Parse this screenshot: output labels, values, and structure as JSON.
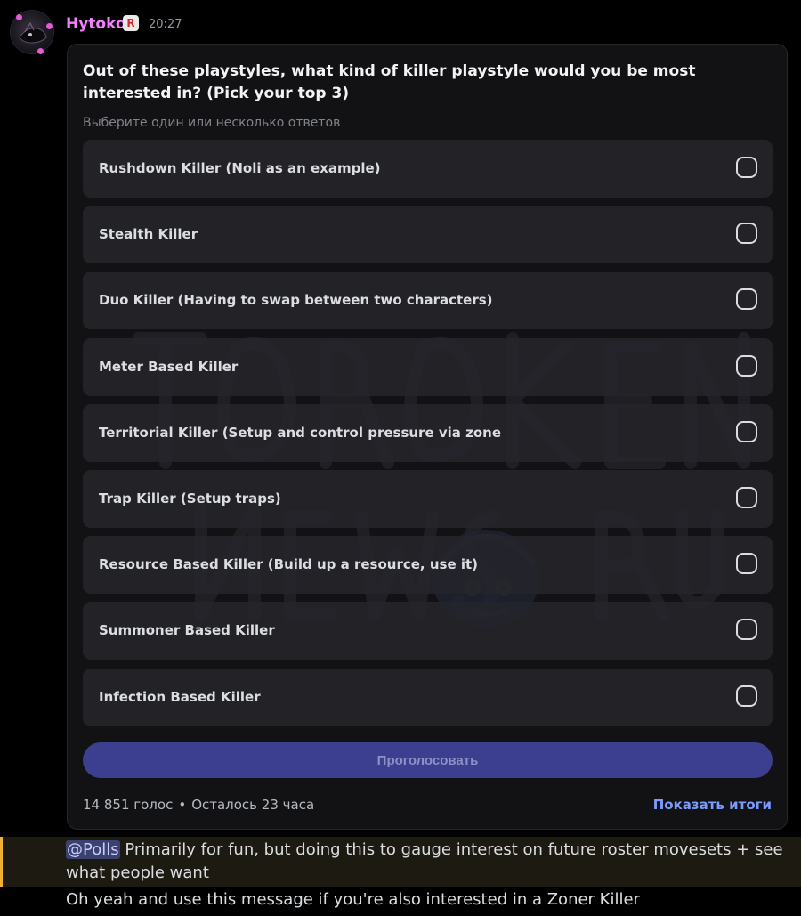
{
  "header": {
    "username": "Hytoko",
    "role_icon": "roblox-icon",
    "timestamp": "20:27"
  },
  "poll": {
    "question": "Out of these playstyles, what kind of killer playstyle would you be most interested in? (Pick your top 3)",
    "hint": "Выберите один или несколько ответов",
    "options": [
      {
        "label": "Rushdown Killer (Noli as an example)",
        "checked": false
      },
      {
        "label": "Stealth Killer",
        "checked": false
      },
      {
        "label": "Duo Killer (Having to swap between two characters)",
        "checked": false
      },
      {
        "label": "Meter Based Killer",
        "checked": false
      },
      {
        "label": "Territorial Killer (Setup and control pressure via zone",
        "checked": false
      },
      {
        "label": "Trap Killer (Setup traps)",
        "checked": false
      },
      {
        "label": "Resource Based Killer (Build up a resource, use it)",
        "checked": false
      },
      {
        "label": "Summoner Based Killer",
        "checked": false
      },
      {
        "label": "Infection Based Killer",
        "checked": false
      }
    ],
    "vote_button": "Проголосовать",
    "votes": "14 851 голос",
    "separator": "•",
    "time_left": "Осталось 23 часа",
    "show_results": "Показать итоги"
  },
  "messages": {
    "mention": "@Polls",
    "line1_rest": " Primarily for fun, but doing this to gauge interest on future roster movesets + see what people want",
    "line2": "Oh yeah and use this message if you're also interested in a Zoner Killer"
  },
  "colors": {
    "username": "#f47fff",
    "vote_button_bg": "#3c3f8f",
    "link": "#7c9bff",
    "mention_highlight": "#f0b232"
  }
}
